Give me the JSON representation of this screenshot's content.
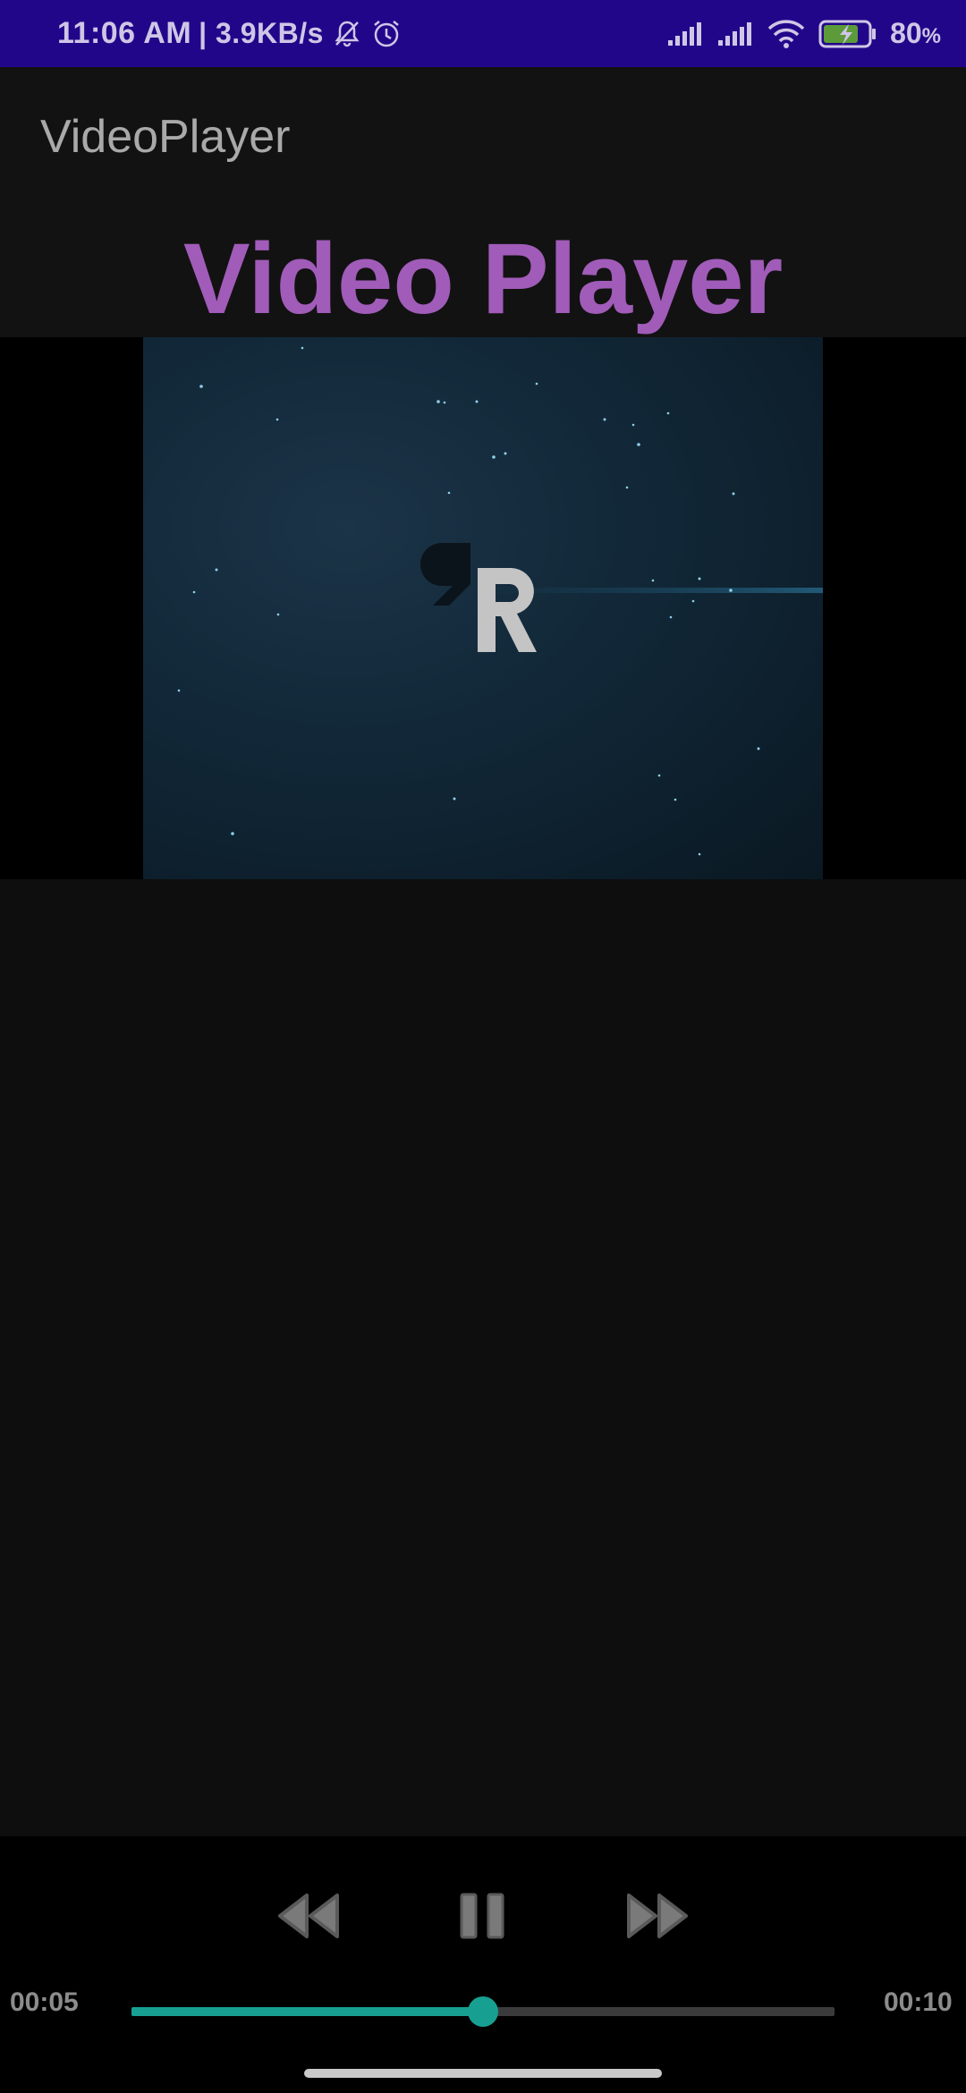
{
  "status_bar": {
    "time": "11:06 AM",
    "net_speed": "| 3.9KB/s",
    "battery_percent": "80",
    "battery_unit": "%",
    "icons": [
      "mute-bell-icon",
      "alarm-icon",
      "signal-icon",
      "signal-icon",
      "wifi-icon",
      "battery-charging-icon"
    ]
  },
  "app_bar": {
    "title": "VideoPlayer"
  },
  "heading": {
    "text": "Video Player"
  },
  "video": {
    "logo_icon": "rr-logo-icon"
  },
  "player": {
    "current_time": "00:05",
    "total_time": "00:10",
    "progress": 0.5,
    "buttons": {
      "rewind": "rewind-icon",
      "pause": "pause-icon",
      "fast_forward": "fast-forward-icon"
    }
  },
  "colors": {
    "status_bar": "#22068a",
    "accent_heading": "#a05cb8",
    "seek_accent": "#17a092"
  }
}
